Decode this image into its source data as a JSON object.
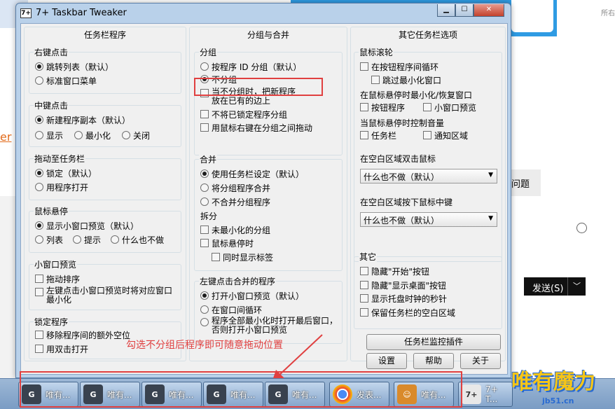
{
  "window": {
    "title": "7+ Taskbar Tweaker"
  },
  "cols": {
    "left": {
      "header": "任务栏程序",
      "rightclick": {
        "label": "右键点击",
        "options": [
          "跳转列表（默认）",
          "标准窗口菜单"
        ]
      },
      "middleclick": {
        "label": "中键点击",
        "options": [
          "新建程序副本（默认）",
          "显示",
          "最小化",
          "关闭"
        ]
      },
      "drag": {
        "label": "拖动至任务栏",
        "options": [
          "锁定（默认）",
          "用程序打开"
        ]
      },
      "hover": {
        "label": "鼠标悬停",
        "options": [
          "显示小窗口预览（默认）",
          "列表",
          "提示",
          "什么也不做"
        ]
      },
      "thumb": {
        "label": "小窗口预览",
        "options": [
          "拖动排序",
          "左键点击小窗口预览时将对应窗口",
          "最小化"
        ]
      },
      "pinned": {
        "label": "锁定程序",
        "options": [
          "移除程序间的额外空位",
          "用双击打开"
        ]
      }
    },
    "mid": {
      "header": "分组与合并",
      "group": {
        "label": "分组",
        "options": [
          "按程序 ID 分组（默认）",
          "不分组",
          "当不分组时，把新程序",
          "放在已有的边上",
          "不将已锁定程序分组",
          "用鼠标右键在分组之间拖动"
        ]
      },
      "combine": {
        "label": "合并",
        "options": [
          "使用任务栏设定（默认）",
          "将分组程序合并",
          "不合并分组程序"
        ]
      },
      "split": {
        "label": "拆分",
        "options": [
          "未最小化的分组",
          "鼠标悬停时",
          "同时显示标签"
        ]
      },
      "leftclick": {
        "label": "左键点击合并的程序",
        "options": [
          "打开小窗口预览（默认）",
          "在窗口间循环",
          "程序全部最小化时打开最后窗口，",
          "否则打开小窗口预览"
        ]
      }
    },
    "right": {
      "header": "其它任务栏选项",
      "wheel": {
        "label": "鼠标滚轮",
        "options": [
          "在按钮程序间循环",
          "跳过最小化窗口"
        ]
      },
      "hoverwheel": {
        "label": "在鼠标悬停时最小化/恢复窗口",
        "options": [
          "按钮程序",
          "小窗口预览"
        ]
      },
      "volume": {
        "label": "当鼠标悬停时控制音量",
        "options": [
          "任务栏",
          "通知区域"
        ]
      },
      "dbl": {
        "label": "在空白区域双击鼠标",
        "value": "什么也不做（默认）"
      },
      "mid": {
        "label": "在空白区域按下鼠标中键",
        "value": "什么也不做（默认）"
      },
      "other": {
        "label": "其它",
        "options": [
          "隐藏\"开始\"按钮",
          "隐藏\"显示桌面\"按钮",
          "显示托盘时钟的秒针",
          "保留任务栏的空白区域"
        ]
      },
      "buttons": {
        "inspector": "任务栏监控插件",
        "settings": "设置",
        "help": "帮助",
        "about": "关于"
      }
    }
  },
  "annotation": "勾选不分组后程序即可随意拖动位置",
  "taskbar": {
    "items": [
      {
        "label": "唯有..."
      },
      {
        "label": "唯有..."
      },
      {
        "label": "唯有..."
      },
      {
        "label": "唯有..."
      },
      {
        "label": "唯有..."
      },
      {
        "label": "发表..."
      },
      {
        "label": "唯有..."
      },
      {
        "label": "7+ T..."
      }
    ],
    "watermark": "唯有魔力",
    "watermark_url": "jb51.cn"
  },
  "background": {
    "corner": "所右",
    "link": "er",
    "question": "问题",
    "send": "发送(S)"
  },
  "colors": {
    "accent_red": "#e04040",
    "window_frame": "#b9d1ea"
  }
}
